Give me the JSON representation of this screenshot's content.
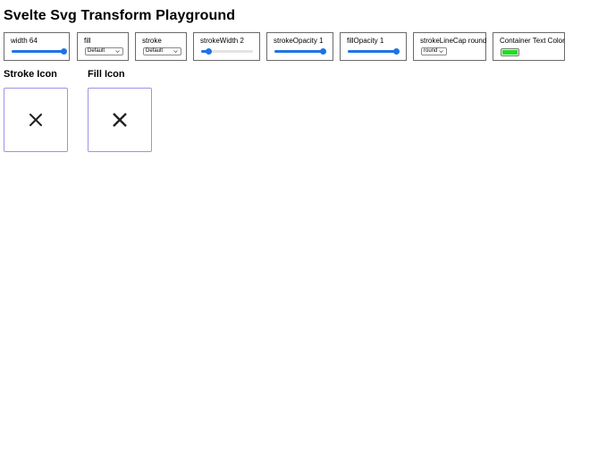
{
  "page": {
    "title": "Svelte Svg Transform Playground"
  },
  "controls": {
    "width": {
      "label": "width 64",
      "value": 64,
      "min": 0,
      "max": 64
    },
    "fill": {
      "label": "fill",
      "selected": "Default"
    },
    "stroke": {
      "label": "stroke",
      "selected": "Default"
    },
    "strokeWidth": {
      "label": "strokeWidth 2",
      "value": 2,
      "min": 0,
      "max": 20
    },
    "strokeOpacity": {
      "label": "strokeOpacity 1",
      "value": 1,
      "min": 0,
      "max": 1
    },
    "fillOpacity": {
      "label": "fillOpacity 1",
      "value": 1,
      "min": 0,
      "max": 1
    },
    "strokeLineCap": {
      "label": "strokeLineCap round",
      "selected": "round"
    },
    "containerTextColor": {
      "label": "Container Text Color",
      "color": "#22dd22"
    }
  },
  "sections": {
    "stroke_icon": {
      "title": "Stroke Icon"
    },
    "fill_icon": {
      "title": "Fill Icon"
    }
  },
  "icons": {
    "stroke": "close-x-icon",
    "fill": "close-x-icon"
  },
  "colors": {
    "accent": "#1f73e6",
    "icon_border": "#9b93e6",
    "icon": "#222222"
  }
}
